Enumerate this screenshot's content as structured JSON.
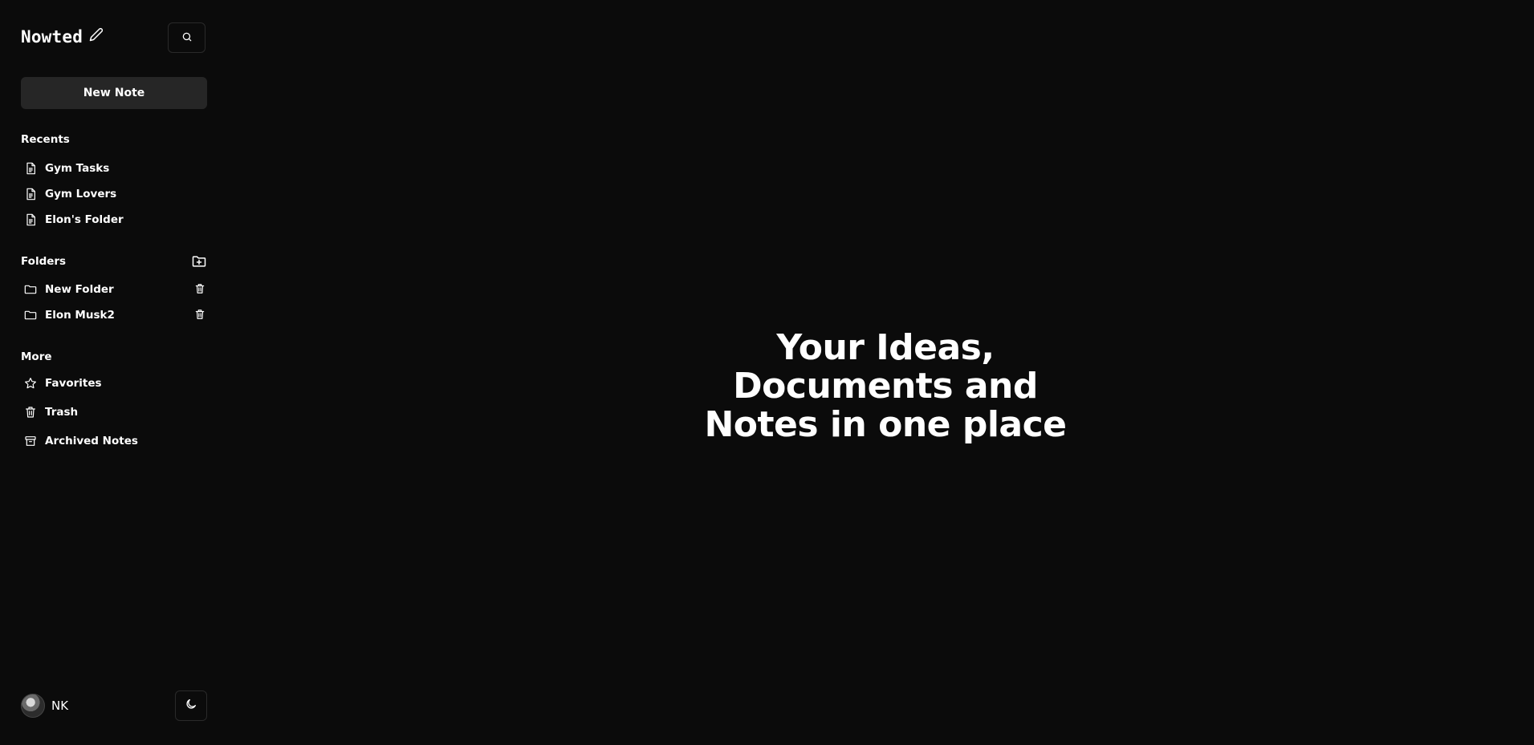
{
  "app": {
    "title": "Nowted",
    "search_icon": "search-icon",
    "edit_icon": "pencil-icon"
  },
  "new_note": {
    "label": "New Note"
  },
  "recents": {
    "heading": "Recents",
    "items": [
      {
        "label": "Gym Tasks",
        "icon": "document-icon"
      },
      {
        "label": "Gym Lovers",
        "icon": "document-icon"
      },
      {
        "label": "Elon's Folder",
        "icon": "document-icon"
      }
    ]
  },
  "folders": {
    "heading": "Folders",
    "add_icon": "folder-plus-icon",
    "items": [
      {
        "label": "New Folder",
        "icon": "folder-icon",
        "action_icon": "trash-icon"
      },
      {
        "label": "Elon Musk2",
        "icon": "folder-icon",
        "action_icon": "trash-icon"
      }
    ]
  },
  "more": {
    "heading": "More",
    "items": [
      {
        "label": "Favorites",
        "icon": "star-icon"
      },
      {
        "label": "Trash",
        "icon": "trash-icon"
      },
      {
        "label": "Archived Notes",
        "icon": "archive-icon"
      }
    ]
  },
  "user": {
    "initials": "NK"
  },
  "theme_toggle": {
    "icon": "moon-icon"
  },
  "hero": {
    "line1": "Your Ideas,",
    "line2": "Documents and",
    "line3": "Notes in one place"
  },
  "colors": {
    "background": "#0b0b0b",
    "button_bg": "#262626",
    "border": "#2a2a2a",
    "text": "#ffffff"
  }
}
